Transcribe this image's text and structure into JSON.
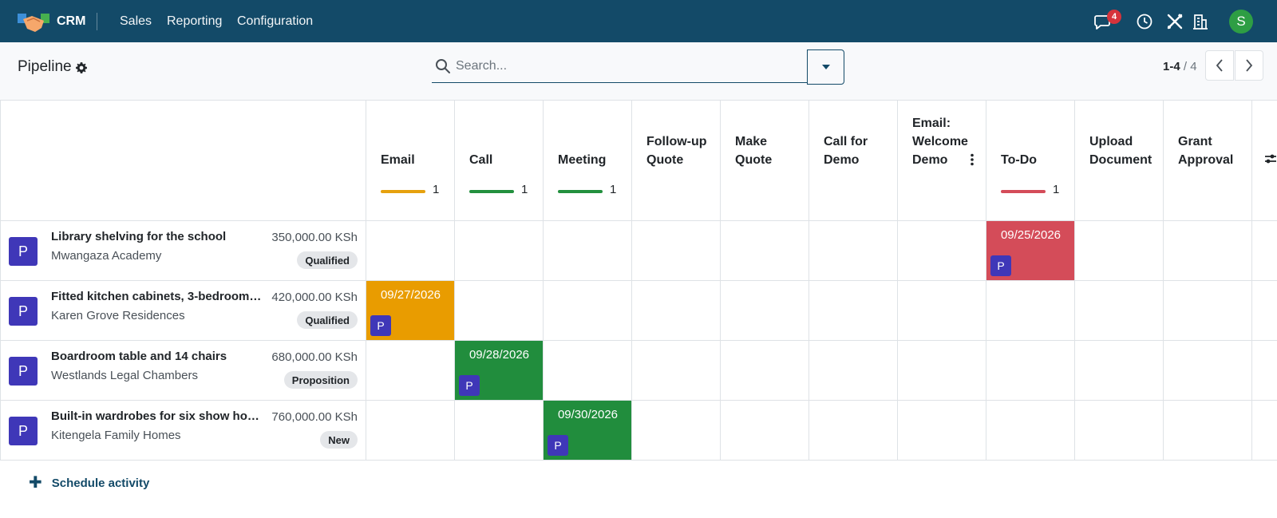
{
  "navbar": {
    "app_name": "CRM",
    "menu": [
      "Sales",
      "Reporting",
      "Configuration"
    ],
    "messages_count": "4",
    "user_initial": "S",
    "icons": [
      "messages-icon",
      "clock-icon",
      "tools-icon",
      "building-icon"
    ]
  },
  "control": {
    "title": "Pipeline",
    "search_placeholder": "Search...",
    "pager_range": "1-4",
    "pager_total": "4"
  },
  "columns": [
    {
      "label": "Email",
      "count": "1",
      "color": "#e6a10e"
    },
    {
      "label": "Call",
      "count": "1",
      "color": "#23903e"
    },
    {
      "label": "Meeting",
      "count": "1",
      "color": "#23903e"
    },
    {
      "label": "Follow-up Quote",
      "count": "",
      "color": ""
    },
    {
      "label": "Make Quote",
      "count": "",
      "color": ""
    },
    {
      "label": "Call for Demo",
      "count": "",
      "color": ""
    },
    {
      "label": "Email: Welcome Demo",
      "count": "",
      "color": ""
    },
    {
      "label": "To-Do",
      "count": "1",
      "color": "#d44c59"
    },
    {
      "label": "Upload Document",
      "count": "",
      "color": ""
    },
    {
      "label": "Grant Approval",
      "count": "",
      "color": ""
    }
  ],
  "records": [
    {
      "avatar": "P",
      "name": "Library shelving for the school",
      "partner": "Mwangaza Academy",
      "amount": "350,000.00 KSh",
      "stage": "Qualified",
      "activity": {
        "col": 7,
        "date": "09/25/2026",
        "color": "#d44c59",
        "avatar": "P"
      }
    },
    {
      "avatar": "P",
      "name": "Fitted kitchen cabinets, 3-bedroom …",
      "partner": "Karen Grove Residences",
      "amount": "420,000.00 KSh",
      "stage": "Qualified",
      "activity": {
        "col": 0,
        "date": "09/27/2026",
        "color": "#e99c00",
        "avatar": "P"
      }
    },
    {
      "avatar": "P",
      "name": "Boardroom table and 14 chairs",
      "partner": "Westlands Legal Chambers",
      "amount": "680,000.00 KSh",
      "stage": "Proposition",
      "activity": {
        "col": 1,
        "date": "09/28/2026",
        "color": "#218d3d",
        "avatar": "P"
      }
    },
    {
      "avatar": "P",
      "name": "Built-in wardrobes for six show hou…",
      "partner": "Kitengela Family Homes",
      "amount": "760,000.00 KSh",
      "stage": "New",
      "activity": {
        "col": 2,
        "date": "09/30/2026",
        "color": "#218d3d",
        "avatar": "P"
      }
    }
  ],
  "footer": {
    "schedule_label": "Schedule activity"
  }
}
